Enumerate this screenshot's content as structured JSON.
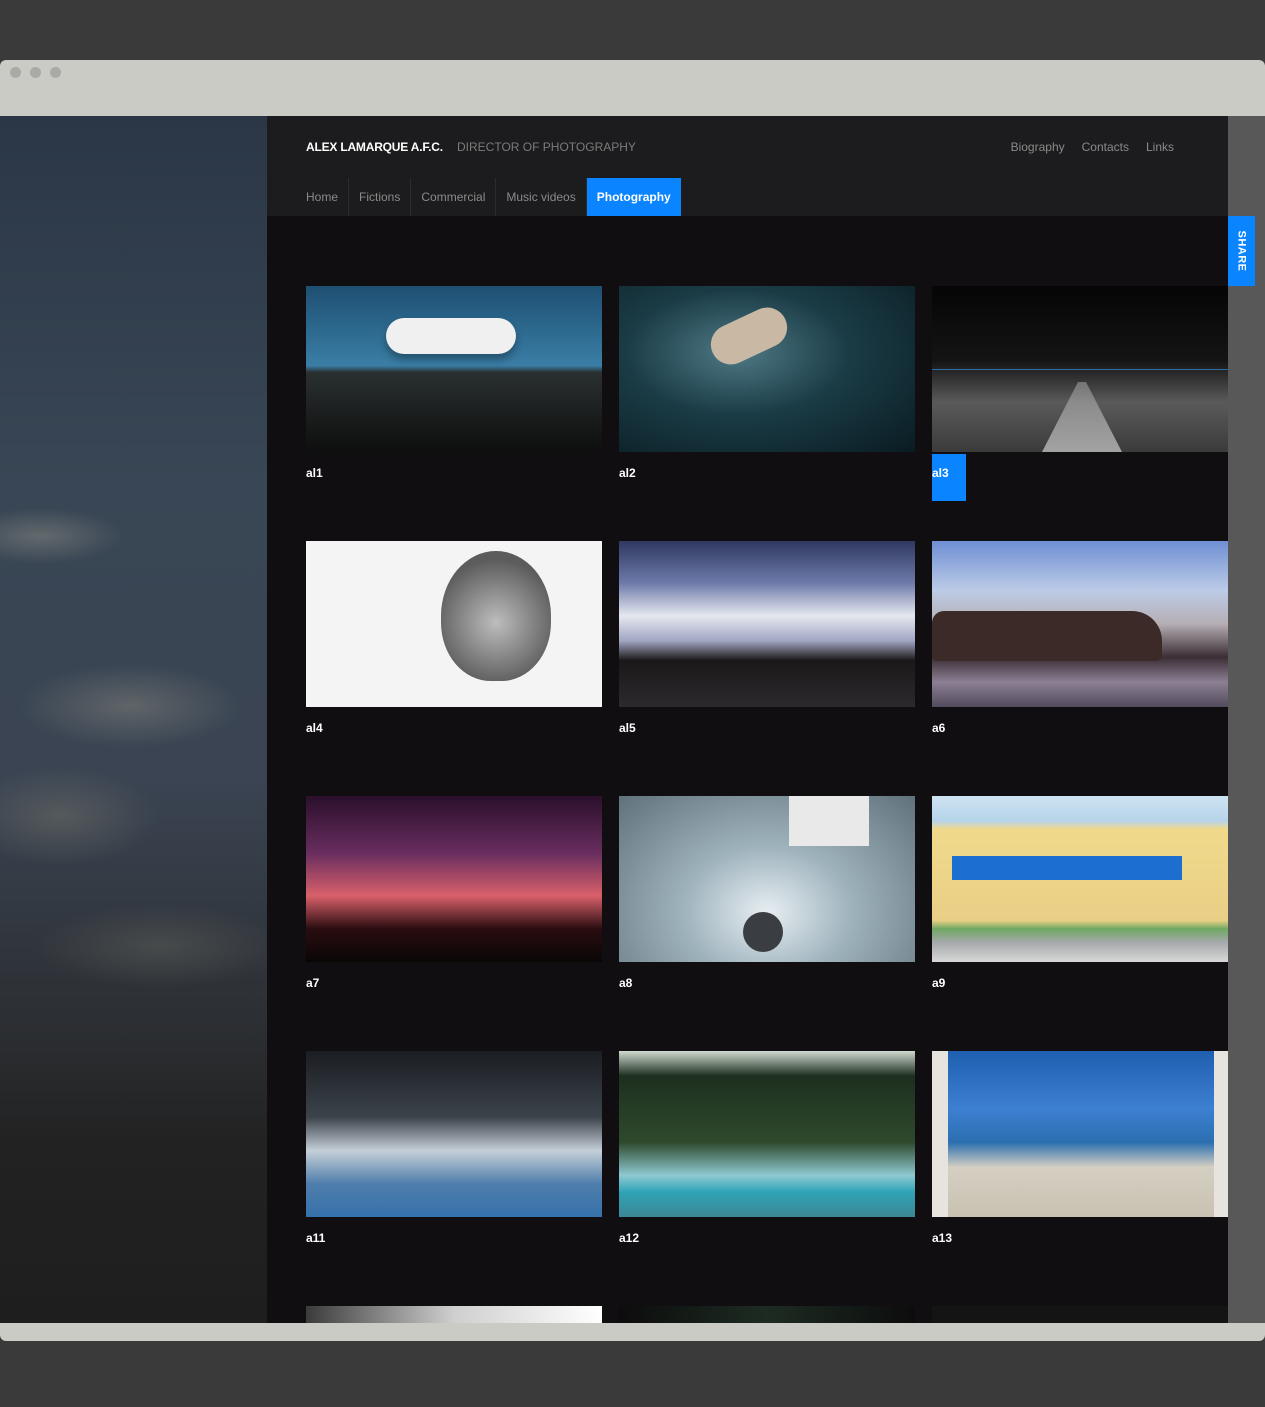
{
  "site": {
    "brand": "ALEX LAMARQUE A.F.C.",
    "tagline": "DIRECTOR OF PHOTOGRAPHY"
  },
  "top_nav": [
    "Biography",
    "Contacts",
    "Links"
  ],
  "main_nav": {
    "tabs": [
      "Home",
      "Fictions",
      "Commercial",
      "Music videos",
      "Photography"
    ],
    "active": "Photography"
  },
  "share": {
    "label": "SHARE"
  },
  "gallery": {
    "items": [
      {
        "caption": "al1"
      },
      {
        "caption": "al2"
      },
      {
        "caption": "al3"
      },
      {
        "caption": "al4"
      },
      {
        "caption": "al5"
      },
      {
        "caption": "a6"
      },
      {
        "caption": "a7"
      },
      {
        "caption": "a8"
      },
      {
        "caption": "a9"
      },
      {
        "caption": "a11"
      },
      {
        "caption": "a12"
      },
      {
        "caption": "a13"
      }
    ]
  },
  "colors": {
    "accent": "#0a84ff",
    "background": "#100e10",
    "header": "#1c1c1e"
  }
}
